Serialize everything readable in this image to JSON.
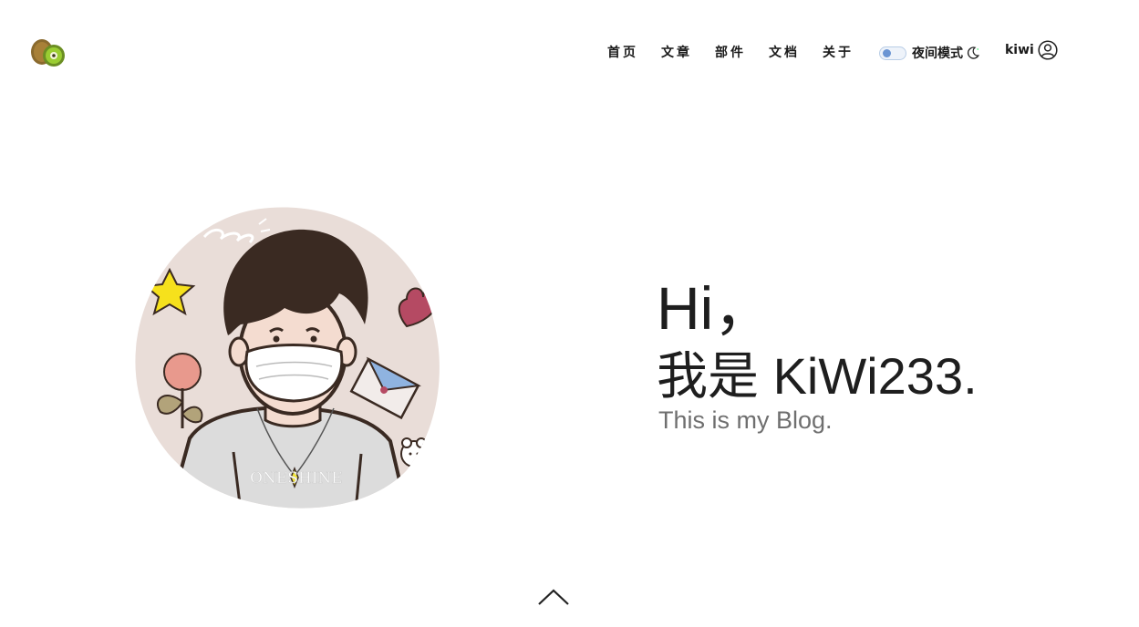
{
  "header": {
    "logo_icon": "kiwi-logo-icon",
    "nav": [
      {
        "label": "首页",
        "active": true
      },
      {
        "label": "文章",
        "active": false
      },
      {
        "label": "部件",
        "active": false
      },
      {
        "label": "文档",
        "active": false
      },
      {
        "label": "关于",
        "active": false
      }
    ],
    "night_mode": {
      "label": "夜间模式",
      "icon": "moon-icon",
      "enabled": false
    },
    "user": {
      "name": "kiwi",
      "icon": "user-circle-icon"
    }
  },
  "hero": {
    "greeting": "Hi，",
    "intro_prefix": "我是 ",
    "name": "KiWi233",
    "intro_suffix": ".",
    "subtitle": "This is my Blog."
  },
  "avatar": {
    "shirt_text": "ONESHINE"
  },
  "colors": {
    "accent": "#7cf2a1",
    "text": "#1e1e1e",
    "subtext": "#6f6f6f",
    "switch_knob": "#6b95d3"
  },
  "footer": {
    "scroll_icon": "chevron-up-icon"
  }
}
